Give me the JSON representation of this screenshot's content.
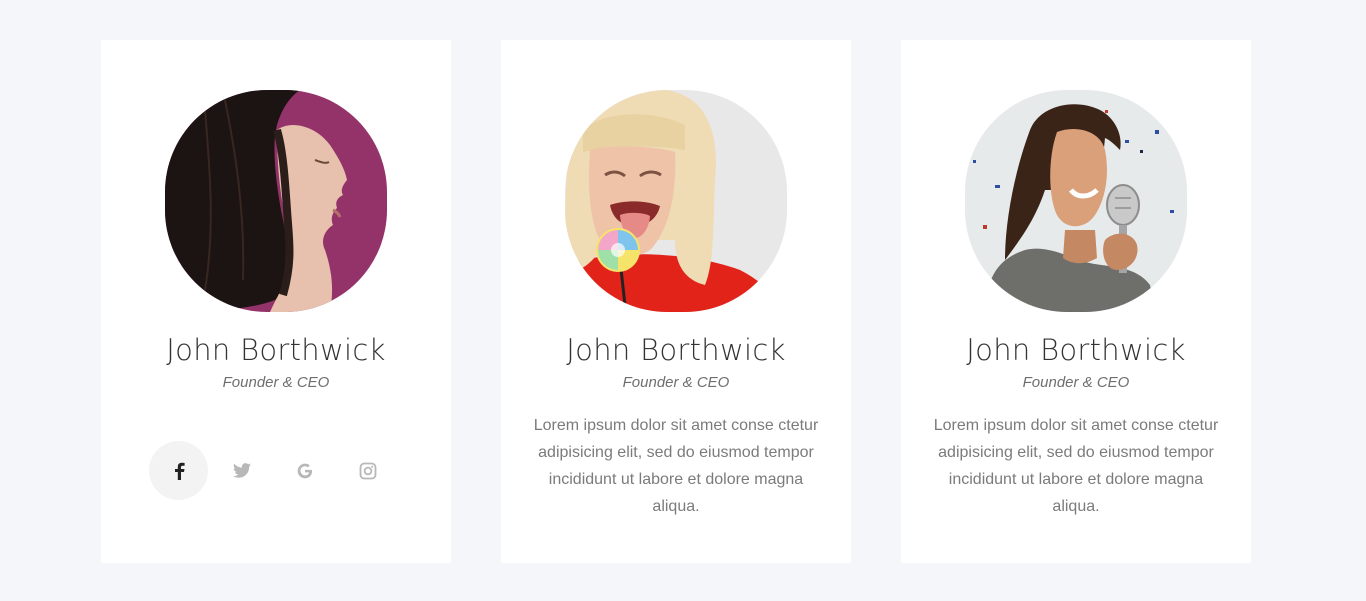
{
  "team": [
    {
      "name": "John Borthwick",
      "role": "Founder & CEO",
      "photo": {
        "icon": "woman-profile-portrait",
        "bg": "#94336a"
      },
      "socials": [
        {
          "icon": "facebook-icon",
          "active": true
        },
        {
          "icon": "twitter-icon",
          "active": false
        },
        {
          "icon": "google-icon",
          "active": false
        },
        {
          "icon": "instagram-icon",
          "active": false
        }
      ]
    },
    {
      "name": "John Borthwick",
      "role": "Founder & CEO",
      "bio": "Lorem ipsum dolor sit amet conse ctetur adipisicing elit, sed do eiusmod tempor incididunt ut labore et dolore magna aliqua.",
      "photo": {
        "icon": "woman-lollipop-portrait",
        "bg": "#e8e8e8"
      }
    },
    {
      "name": "John Borthwick",
      "role": "Founder & CEO",
      "bio": "Lorem ipsum dolor sit amet conse ctetur adipisicing elit, sed do eiusmod tempor incididunt ut labore et dolore magna aliqua.",
      "photo": {
        "icon": "man-microphone-portrait",
        "bg": "#e6eaeb"
      }
    }
  ],
  "colors": {
    "page_bg": "#f5f6fa",
    "card_bg": "#ffffff",
    "active_social_bg": "#f3f3f3",
    "inactive_social_icon": "#b8b8b8",
    "active_social_icon": "#222222"
  }
}
